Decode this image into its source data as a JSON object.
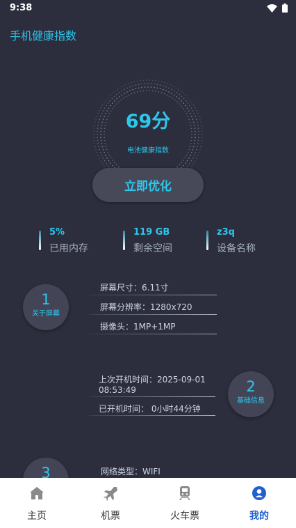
{
  "status_bar": {
    "time": "9:38"
  },
  "header": {
    "title": "手机健康指数"
  },
  "score": {
    "value": "69分",
    "label": "电池健康指数"
  },
  "optimize_button": {
    "label": "立即优化"
  },
  "stats": [
    {
      "value": "5%",
      "label": "已用内存"
    },
    {
      "value": "119 GB",
      "label": "剩余空间"
    },
    {
      "value": "z3q",
      "label": "设备名称"
    }
  ],
  "sections": [
    {
      "number": "1",
      "title": "关于屏幕",
      "lines": [
        "屏幕尺寸：6.11寸",
        "屏幕分辨率：1280x720",
        "摄像头：1MP+1MP"
      ]
    },
    {
      "number": "2",
      "title": "基础信息",
      "lines": [
        "上次开机时间：2025-09-01",
        "08:53:49",
        "已开机时间： 0小时44分钟"
      ]
    },
    {
      "number": "3",
      "title": "",
      "lines": [
        "网络类型：WIFI"
      ]
    }
  ],
  "tabs": [
    {
      "label": "主页",
      "icon": "home-icon"
    },
    {
      "label": "机票",
      "icon": "airplane-icon"
    },
    {
      "label": "火车票",
      "icon": "train-icon"
    },
    {
      "label": "我的",
      "icon": "user-icon"
    }
  ],
  "colors": {
    "background": "#2c2d3d",
    "accent": "#2ec7ec",
    "active_tab": "#1f5fd0",
    "inactive_icon": "#8a8a8a"
  }
}
